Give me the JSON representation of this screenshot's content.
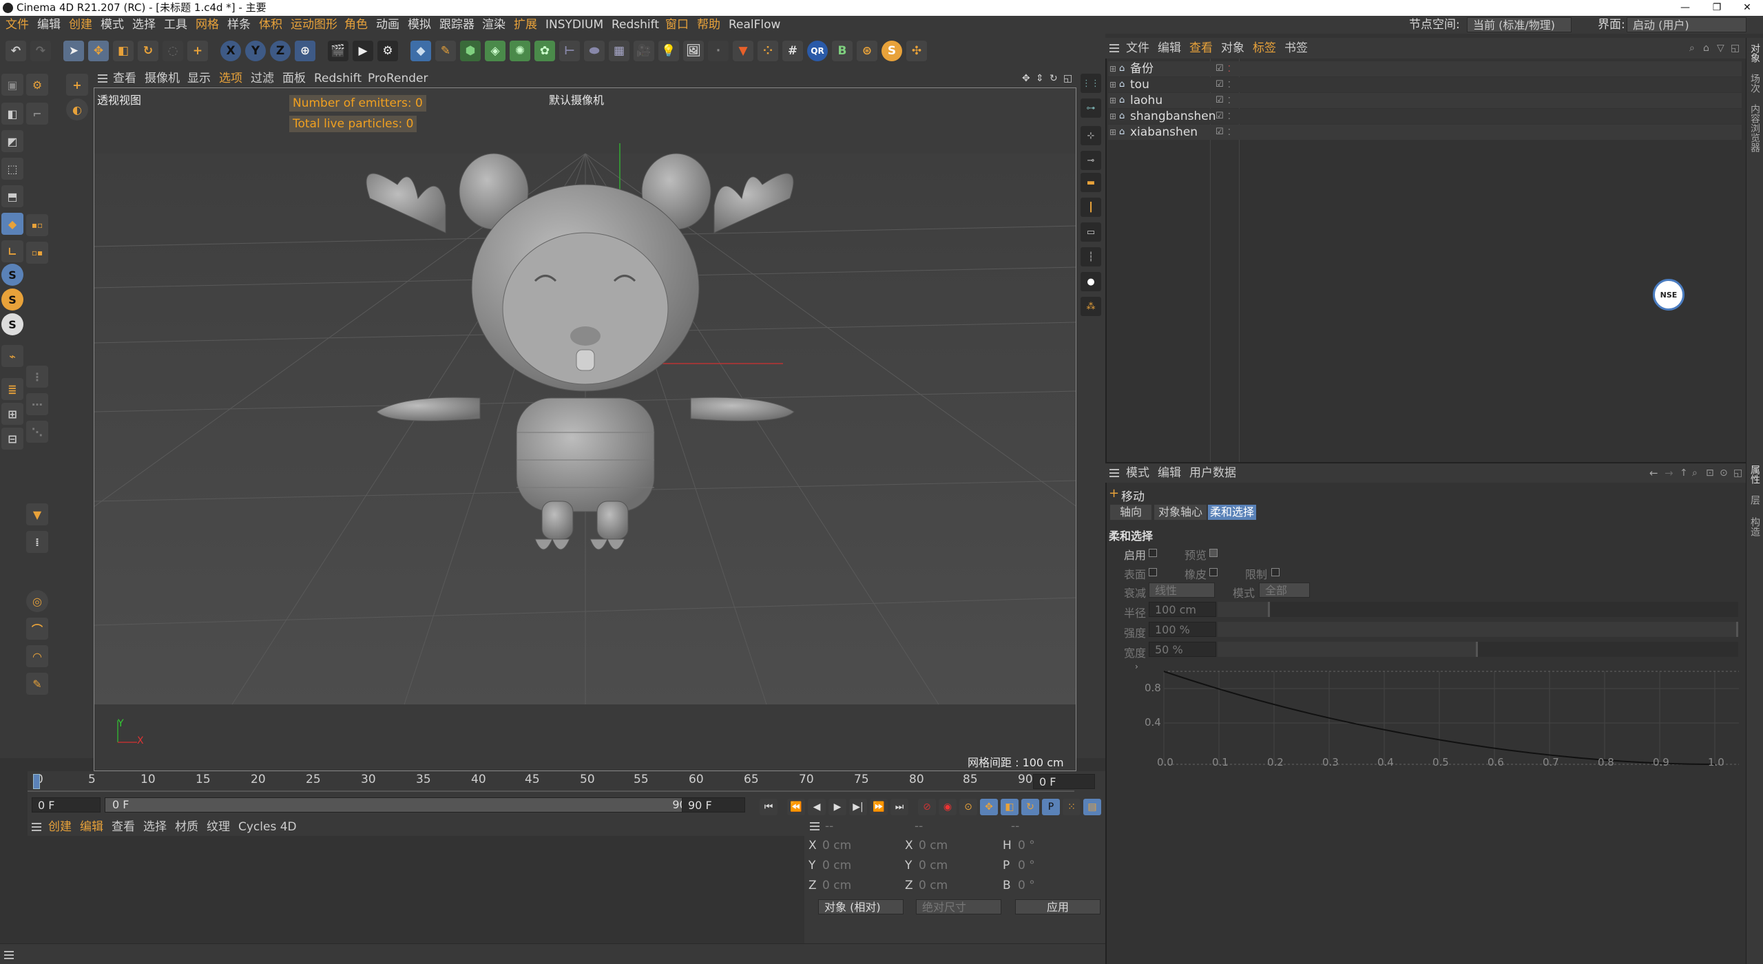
{
  "window": {
    "title": "Cinema 4D R21.207 (RC) - [未标题 1.c4d *] - 主要",
    "minimize": "—",
    "restore": "❐",
    "close": "✕"
  },
  "menubar": {
    "items": [
      "文件",
      "编辑",
      "创建",
      "模式",
      "选择",
      "工具",
      "网格",
      "样条",
      "体积",
      "运动图形",
      "角色",
      "动画",
      "模拟",
      "跟踪器",
      "渲染",
      "扩展",
      "INSYDIUM",
      "Redshift",
      "窗口",
      "帮助",
      "RealFlow"
    ],
    "node_space_label": "节点空间:",
    "node_space_value": "当前 (标准/物理)",
    "layout_label": "界面:",
    "layout_value": "启动 (用户)"
  },
  "toolbar": {
    "axis_x": "X",
    "axis_y": "Y",
    "axis_z": "Z"
  },
  "viewport": {
    "menu": [
      "查看",
      "摄像机",
      "显示",
      "选项",
      "过滤",
      "面板",
      "Redshift",
      "ProRender"
    ],
    "view_name": "透视视图",
    "camera_name": "默认摄像机",
    "hud_emitters": "Number of emitters: 0",
    "hud_particles": "Total live particles: 0",
    "grid_spacing": "网格间距 : 100 cm",
    "axis_y_label": "Y",
    "axis_x_label": "X"
  },
  "timeline": {
    "ticks": [
      "0",
      "5",
      "10",
      "15",
      "20",
      "25",
      "30",
      "35",
      "40",
      "45",
      "50",
      "55",
      "60",
      "65",
      "70",
      "75",
      "80",
      "85",
      "90"
    ],
    "current_frame_field": "0 F",
    "start_field": "0 F",
    "range_start": "0 F",
    "range_end": "90 F",
    "end_field": "90 F",
    "playhead_fraction": 0.0
  },
  "materials": {
    "menu": [
      "创建",
      "编辑",
      "查看",
      "选择",
      "材质",
      "纹理",
      "Cycles 4D"
    ]
  },
  "coordinates": {
    "header": [
      "--",
      "--",
      "--"
    ],
    "rows": [
      {
        "l1": "X",
        "v1": "0 cm",
        "l2": "X",
        "v2": "0 cm",
        "l3": "H",
        "v3": "0 °"
      },
      {
        "l1": "Y",
        "v1": "0 cm",
        "l2": "Y",
        "v2": "0 cm",
        "l3": "P",
        "v3": "0 °"
      },
      {
        "l1": "Z",
        "v1": "0 cm",
        "l2": "Z",
        "v2": "0 cm",
        "l3": "B",
        "v3": "0 °"
      }
    ],
    "mode_dropdown": "对象 (相对)",
    "size_dropdown": "绝对尺寸",
    "apply_button": "应用"
  },
  "object_manager": {
    "menu": [
      "文件",
      "编辑",
      "查看",
      "对象",
      "标签",
      "书签"
    ],
    "objects": [
      "备份",
      "tou",
      "laohu",
      "shangbanshen",
      "xiabanshen"
    ]
  },
  "attributes": {
    "menu": [
      "模式",
      "编辑",
      "用户数据"
    ],
    "tool_name": "移动",
    "tabs": [
      "轴向",
      "对象轴心",
      "柔和选择"
    ],
    "active_tab": "柔和选择",
    "section": "柔和选择",
    "enable_label": "启用",
    "preview_label": "预览",
    "surface_label": "表面",
    "rubber_label": "橡皮",
    "limit_label": "限制",
    "falloff_label": "衰减",
    "falloff_value": "线性",
    "mode_label": "模式",
    "mode_value": "全部",
    "radius_label": "半径",
    "radius_value": "100 cm",
    "radius_fraction": 0.1,
    "strength_label": "强度",
    "strength_value": "100 %",
    "strength_fraction": 1.0,
    "width_label": "宽度",
    "width_value": "50 %",
    "width_fraction": 0.5,
    "graph_y_ticks": [
      "0.8",
      "0.4"
    ],
    "graph_x_ticks": [
      "0.0",
      "0.1",
      "0.2",
      "0.3",
      "0.4",
      "0.5",
      "0.6",
      "0.7",
      "0.8",
      "0.9",
      "1.0"
    ]
  },
  "side_tabs": [
    "对象",
    "场次",
    "内容浏览器",
    "属性",
    "层",
    "构造"
  ],
  "logo_text": "NSE",
  "colors": {
    "accent": "#e8a23a",
    "selected_tab": "#5a82b8"
  }
}
